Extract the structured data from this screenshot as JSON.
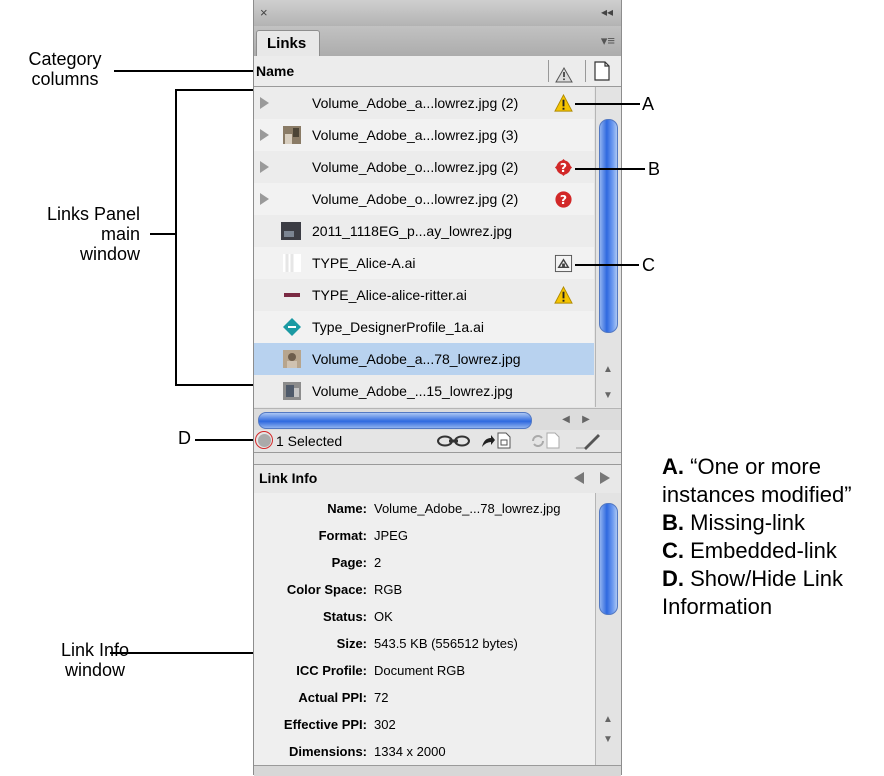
{
  "panel": {
    "tab_label": "Links",
    "column_name": "Name",
    "close_glyph": "×",
    "collapse_glyph": "◂◂",
    "menu_glyph": "▾≡"
  },
  "rows": [
    {
      "label": "Volume_Adobe_a...lowrez.jpg (2)",
      "status": "warning"
    },
    {
      "label": "Volume_Adobe_a...lowrez.jpg (3)",
      "status": "none"
    },
    {
      "label": "Volume_Adobe_o...lowrez.jpg (2)",
      "status": "missing"
    },
    {
      "label": "Volume_Adobe_o...lowrez.jpg (2)",
      "status": "missing"
    },
    {
      "label": "2011_1118EG_p...ay_lowrez.jpg",
      "status": "none"
    },
    {
      "label": "TYPE_Alice-A.ai",
      "status": "embedded"
    },
    {
      "label": "TYPE_Alice-alice-ritter.ai",
      "status": "warning"
    },
    {
      "label": "Type_DesignerProfile_1a.ai",
      "status": "none"
    },
    {
      "label": "Volume_Adobe_a...78_lowrez.jpg",
      "status": "selected"
    },
    {
      "label": "Volume_Adobe_...15_lowrez.jpg",
      "status": "none"
    }
  ],
  "status_bar": {
    "selected_text": "1 Selected"
  },
  "link_info": {
    "title": "Link Info",
    "fields": [
      {
        "key": "Name:",
        "value": "Volume_Adobe_...78_lowrez.jpg"
      },
      {
        "key": "Format:",
        "value": "JPEG"
      },
      {
        "key": "Page:",
        "value": "2"
      },
      {
        "key": "Color Space:",
        "value": "RGB"
      },
      {
        "key": "Status:",
        "value": "OK"
      },
      {
        "key": "Size:",
        "value": "543.5 KB (556512 bytes)"
      },
      {
        "key": "ICC Profile:",
        "value": "Document RGB"
      },
      {
        "key": "Actual PPI:",
        "value": "72"
      },
      {
        "key": "Effective PPI:",
        "value": "302"
      },
      {
        "key": "Dimensions:",
        "value": "1334 x 2000"
      }
    ]
  },
  "annotations": {
    "category_columns_1": "Category",
    "category_columns_2": "columns",
    "links_main_1": "Links Panel",
    "links_main_2": "main",
    "links_main_3": "window",
    "link_info_1": "Link Info",
    "link_info_2": "window",
    "A": "A",
    "B": "B",
    "C": "C",
    "D": "D"
  },
  "legend": [
    {
      "letter": "A.",
      "text": "“One or more"
    },
    {
      "letter": "",
      "text": "instances modified”"
    },
    {
      "letter": "B.",
      "text": "Missing-link"
    },
    {
      "letter": "C.",
      "text": "Embedded-link"
    },
    {
      "letter": "D.",
      "text": "Show/Hide Link"
    },
    {
      "letter": "",
      "text": "Information"
    }
  ]
}
